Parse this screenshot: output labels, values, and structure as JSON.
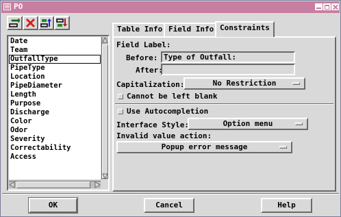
{
  "window": {
    "title": "PO"
  },
  "fields": {
    "items": [
      "Date",
      "Team",
      "OutfallType",
      "PipeType",
      "Location",
      "PipeDiameter",
      "Length",
      "Purpose",
      "Discharge",
      "Color",
      "Odor",
      "Severity",
      "Correctability",
      "Access"
    ],
    "selected": "OutfallType"
  },
  "tabs": {
    "table_info": "Table Info",
    "field_info": "Field Info",
    "constraints": "Constraints",
    "active": "Constraints"
  },
  "constraints": {
    "field_label_heading": "Field Label:",
    "before_label": "Before:",
    "before_value": "Type of Outfall:",
    "after_label": "After:",
    "after_value": "",
    "capitalization_label": "Capitalization:",
    "capitalization_value": "No Restriction",
    "cannot_blank_label": "Cannot be left blank",
    "autocompletion_label": "Use Autocompletion",
    "interface_style_label": "Interface Style:",
    "interface_style_value": "Option menu",
    "invalid_action_label": "Invalid value action:",
    "invalid_action_value": "Popup error message"
  },
  "buttons": {
    "ok": "OK",
    "cancel": "Cancel",
    "help": "Help"
  },
  "colors": {
    "titlebar": "#c77ea0",
    "background": "#d9d9d9",
    "add_icon": "#1f8a1f",
    "delete_icon": "#d62020",
    "move_icon": "#2222cc",
    "move_icon_alt": "#b01818"
  }
}
